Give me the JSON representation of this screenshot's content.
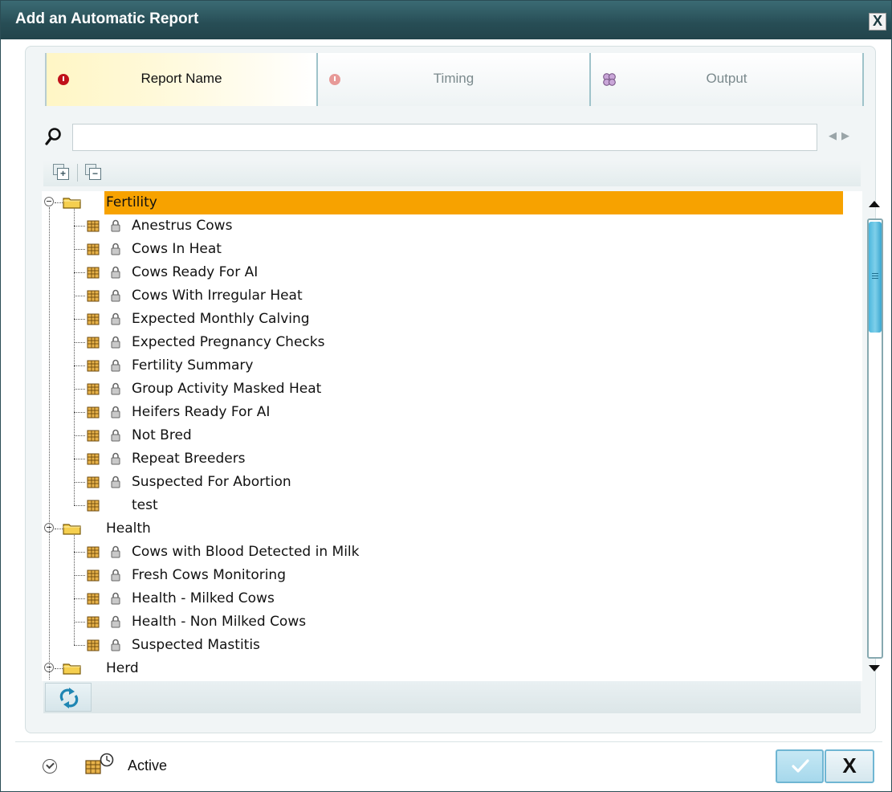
{
  "window": {
    "title": "Add an Automatic Report",
    "close_glyph": "X"
  },
  "tabs": [
    {
      "label": "Report Name",
      "icon": "error-icon",
      "active": true
    },
    {
      "label": "Timing",
      "icon": "error-icon",
      "active": false
    },
    {
      "label": "Output",
      "icon": "output-icon",
      "active": false
    }
  ],
  "search": {
    "value": "",
    "placeholder": ""
  },
  "toolbar": {
    "expand_all_glyph": "+",
    "collapse_all_glyph": "−"
  },
  "tree": {
    "folders": [
      {
        "label": "Fertility",
        "selected": true,
        "items": [
          {
            "label": "Anestrus Cows",
            "locked": true
          },
          {
            "label": "Cows In Heat",
            "locked": true
          },
          {
            "label": "Cows Ready For AI",
            "locked": true
          },
          {
            "label": "Cows With Irregular Heat",
            "locked": true
          },
          {
            "label": "Expected Monthly Calving",
            "locked": true
          },
          {
            "label": "Expected Pregnancy Checks",
            "locked": true
          },
          {
            "label": "Fertility Summary",
            "locked": true
          },
          {
            "label": "Group Activity Masked Heat",
            "locked": true
          },
          {
            "label": "Heifers Ready For AI",
            "locked": true
          },
          {
            "label": "Not Bred",
            "locked": true
          },
          {
            "label": "Repeat Breeders",
            "locked": true
          },
          {
            "label": "Suspected For Abortion",
            "locked": true
          },
          {
            "label": "test",
            "locked": false
          }
        ]
      },
      {
        "label": "Health",
        "selected": false,
        "items": [
          {
            "label": "Cows with Blood Detected in Milk",
            "locked": true
          },
          {
            "label": "Fresh Cows Monitoring",
            "locked": true
          },
          {
            "label": "Health - Milked Cows",
            "locked": true
          },
          {
            "label": "Health - Non Milked Cows",
            "locked": true
          },
          {
            "label": "Suspected Mastitis",
            "locked": true
          }
        ]
      },
      {
        "label": "Herd",
        "selected": false,
        "items": []
      }
    ]
  },
  "footer": {
    "active_label": "Active"
  },
  "colors": {
    "selection": "#f7a200",
    "titlebar": "#2c5159",
    "accent": "#4cb7de"
  }
}
